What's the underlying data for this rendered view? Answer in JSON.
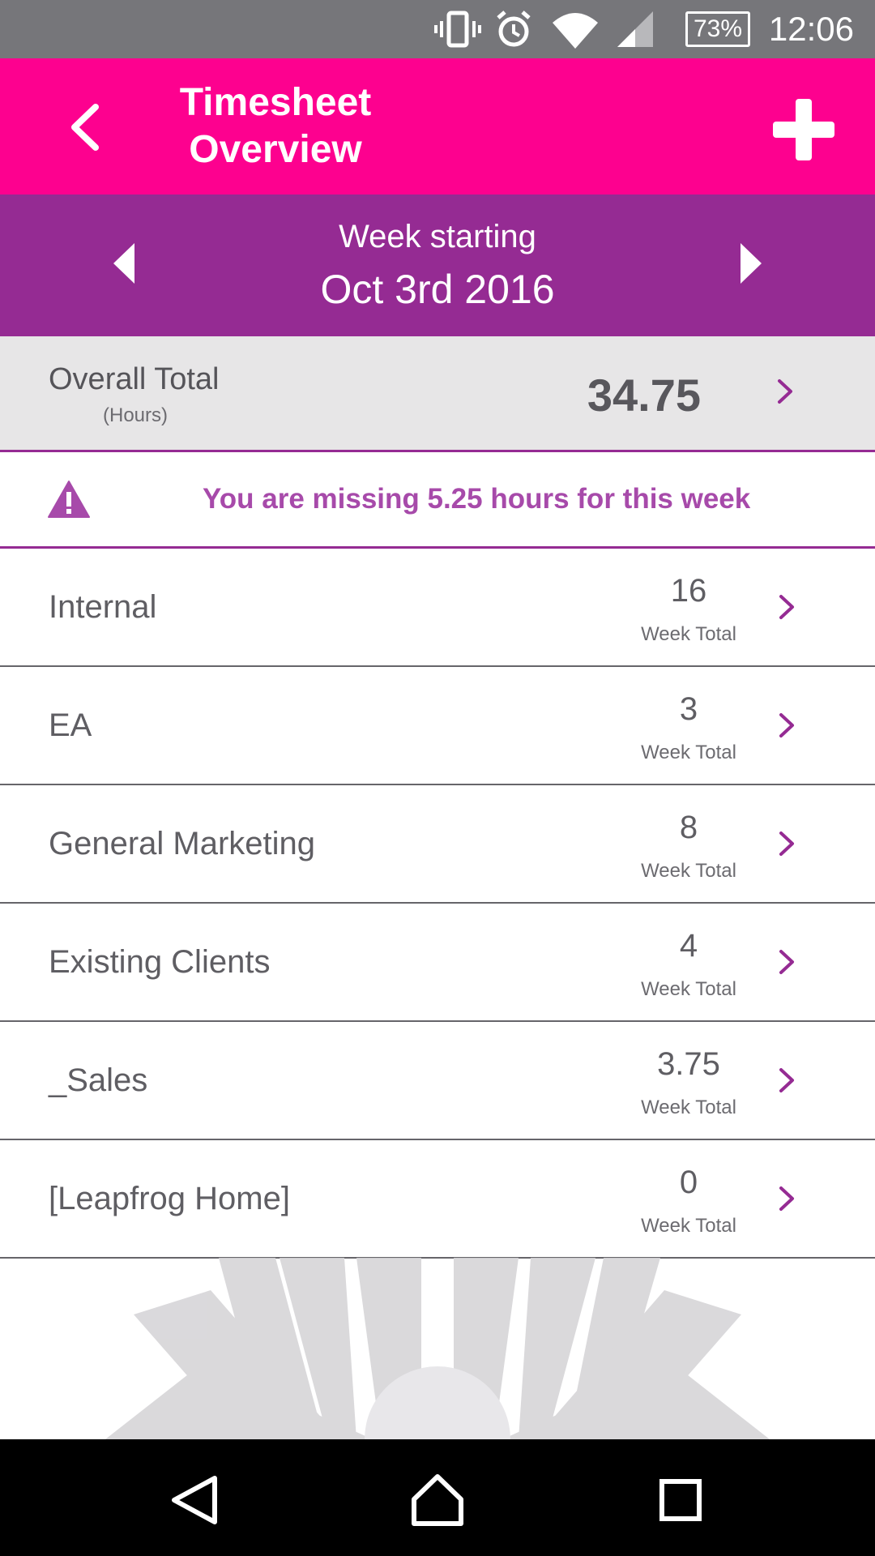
{
  "status_bar": {
    "battery": "73%",
    "time": "12:06",
    "icons": [
      "vibrate-icon",
      "alarm-icon",
      "wifi-icon",
      "signal-icon",
      "battery-icon"
    ]
  },
  "app_bar": {
    "title": "Timesheet\nOverview",
    "back_icon": "chevron-left-icon",
    "add_icon": "plus-icon"
  },
  "week_nav": {
    "label": "Week starting",
    "date": "Oct 3rd 2016"
  },
  "overall": {
    "label": "Overall Total",
    "sub": "(Hours)",
    "value": "34.75"
  },
  "warning": {
    "text": "You are missing 5.25 hours for this week"
  },
  "categories": [
    {
      "name": "Internal",
      "total": "16",
      "total_label": "Week Total"
    },
    {
      "name": "EA",
      "total": "3",
      "total_label": "Week Total"
    },
    {
      "name": "General Marketing",
      "total": "8",
      "total_label": "Week Total"
    },
    {
      "name": "Existing Clients",
      "total": "4",
      "total_label": "Week Total"
    },
    {
      "name": "_Sales",
      "total": "3.75",
      "total_label": "Week Total"
    },
    {
      "name": "[Leapfrog Home]",
      "total": "0",
      "total_label": "Week Total"
    }
  ],
  "colors": {
    "status_bar": "#76767a",
    "app_bar": "#fd018f",
    "week_nav": "#952b93",
    "accent": "#952b93",
    "warning_text": "#a74aaa"
  }
}
